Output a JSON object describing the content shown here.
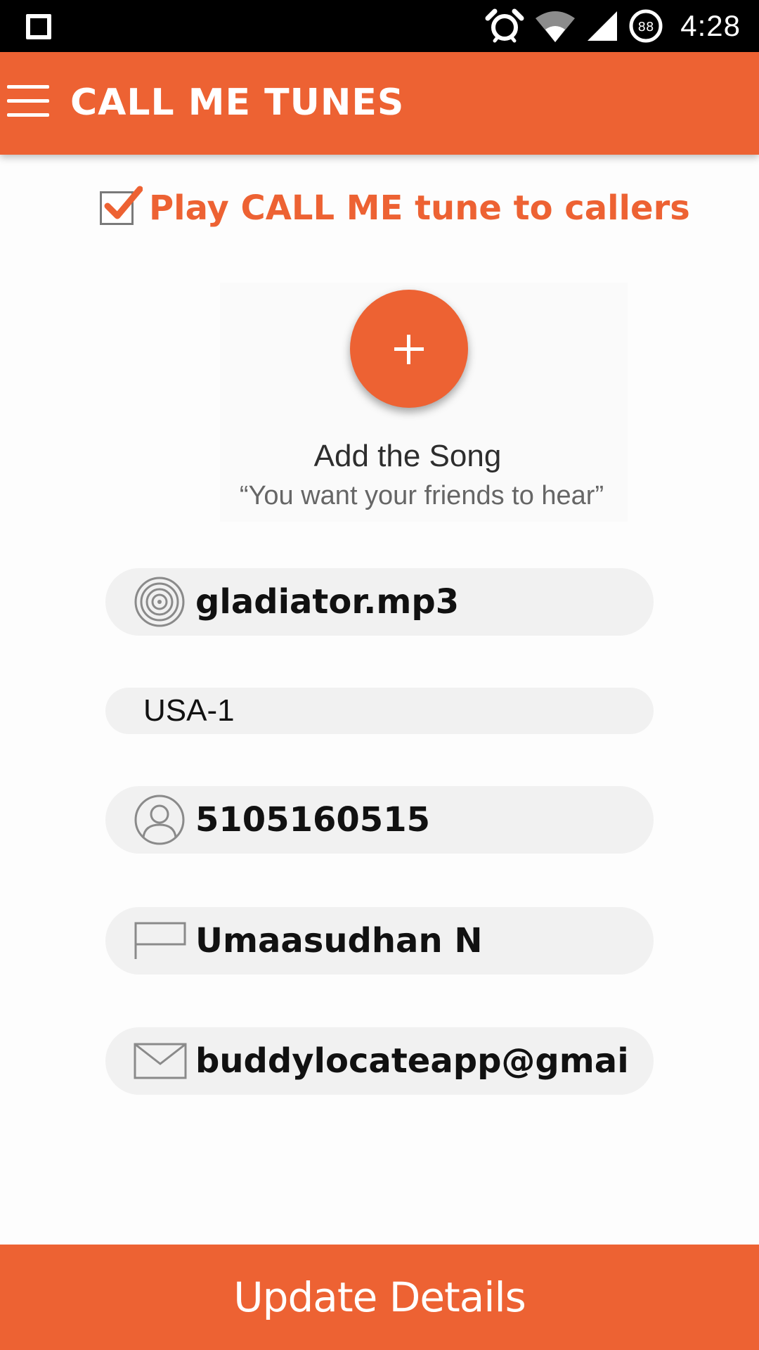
{
  "status_bar": {
    "time": "4:28",
    "battery_level": "88",
    "icons": [
      "square-icon",
      "alarm-icon",
      "wifi-icon",
      "signal-icon",
      "battery-icon"
    ]
  },
  "app_bar": {
    "title": "CALL ME TUNES",
    "menu_icon": "hamburger-menu-icon"
  },
  "play_toggle": {
    "checked": true,
    "label": "Play CALL ME tune to callers"
  },
  "add_song": {
    "title": "Add the Song",
    "subtitle": "“You want your friends to hear”",
    "button_icon": "plus-icon"
  },
  "fields": {
    "song": {
      "icon": "target-icon",
      "value": "gladiator.mp3"
    },
    "region": {
      "value": "USA-1"
    },
    "phone": {
      "icon": "user-icon",
      "value": "5105160515"
    },
    "name": {
      "icon": "flag-icon",
      "value": "Umaasudhan N"
    },
    "email": {
      "icon": "mail-icon",
      "value": "buddylocateapp@gmail.co"
    }
  },
  "update_button": {
    "label": "Update Details"
  },
  "colors": {
    "accent": "#ed6233",
    "field_bg": "#f1f1f1"
  }
}
